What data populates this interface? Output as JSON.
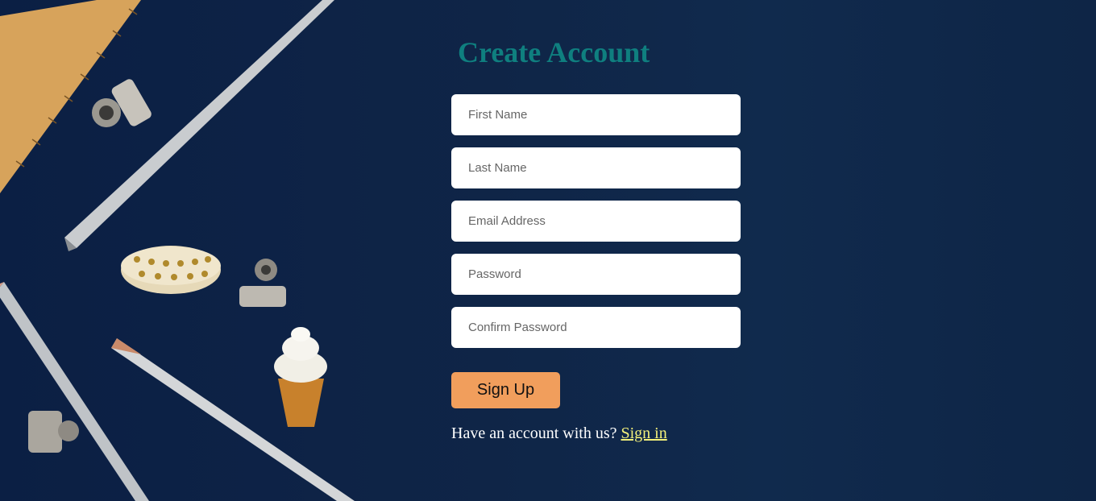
{
  "form": {
    "title": "Create Account",
    "fields": [
      {
        "placeholder": "First Name"
      },
      {
        "placeholder": "Last Name"
      },
      {
        "placeholder": "Email Address"
      },
      {
        "placeholder": "Password"
      },
      {
        "placeholder": "Confirm Password"
      }
    ],
    "signup_label": "Sign Up",
    "signin_prompt": "Have an account with us?",
    "signin_link": "Sign in"
  },
  "colors": {
    "background": "#0b1f44",
    "title": "#0f7f7f",
    "button": "#f19e5c",
    "link": "#f3f07a"
  }
}
